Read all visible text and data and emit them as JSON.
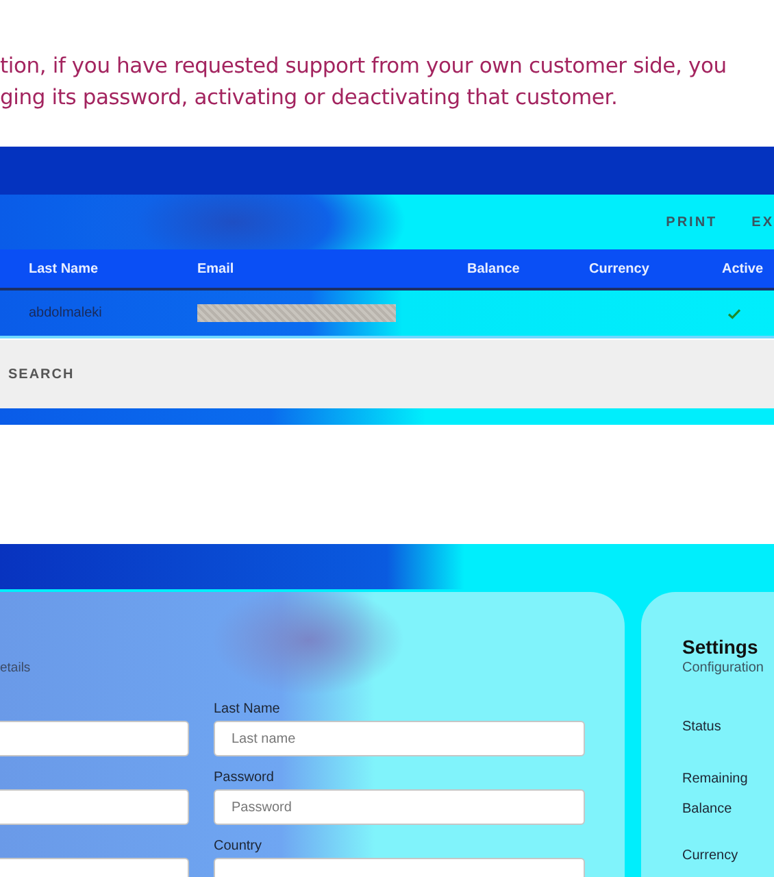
{
  "intro": {
    "lines": [
      "tion, if you have requested support from your own customer side, you",
      "ging its password, activating or deactivating that customer."
    ]
  },
  "customers_screen": {
    "toolbar_actions": [
      "PRINT",
      "EX"
    ],
    "columns": [
      "Last Name",
      "Email",
      "Balance",
      "Currency",
      "Active"
    ],
    "rows": [
      {
        "last_name": "abdolmaleki",
        "email_redacted": true,
        "active": true
      }
    ],
    "search_label": "SEARCH"
  },
  "edit_screen": {
    "section_subtitle": "etails",
    "form_rows": [
      {
        "label": "Last Name",
        "placeholder": "Last name"
      },
      {
        "label": "Password",
        "placeholder": "Password"
      },
      {
        "label": "Country"
      }
    ],
    "settings": {
      "title": "Settings",
      "subtitle": "Configuration",
      "labels": [
        "Status",
        "Remaining Balance",
        "Currency"
      ]
    }
  }
}
